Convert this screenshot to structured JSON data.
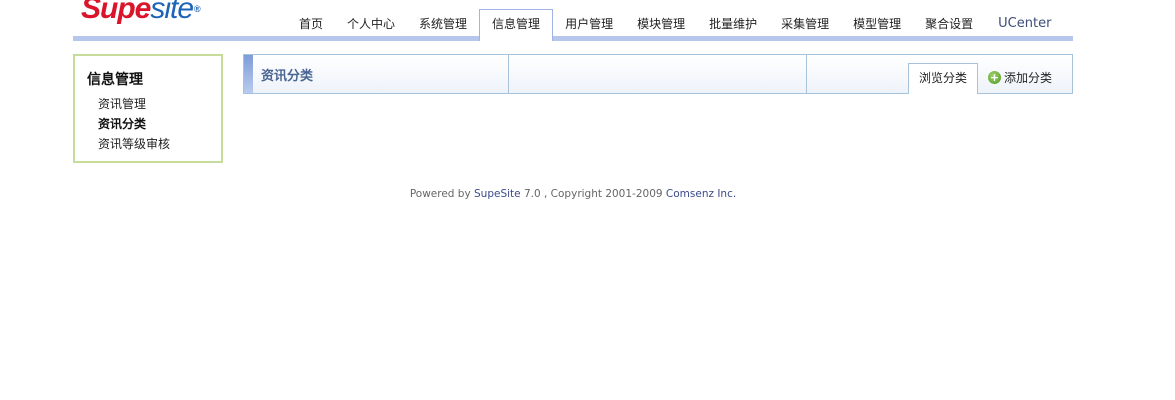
{
  "header": {
    "logo": {
      "part1": "Supe",
      "part2": "site",
      "mark": "®"
    },
    "nav": [
      {
        "label": "首页",
        "active": false
      },
      {
        "label": "个人中心",
        "active": false
      },
      {
        "label": "系统管理",
        "active": false
      },
      {
        "label": "信息管理",
        "active": true
      },
      {
        "label": "用户管理",
        "active": false
      },
      {
        "label": "模块管理",
        "active": false
      },
      {
        "label": "批量维护",
        "active": false
      },
      {
        "label": "采集管理",
        "active": false
      },
      {
        "label": "模型管理",
        "active": false
      },
      {
        "label": "聚合设置",
        "active": false
      },
      {
        "label": "UCenter",
        "active": false
      }
    ]
  },
  "sidebar": {
    "title": "信息管理",
    "items": [
      {
        "label": "资讯管理",
        "current": false
      },
      {
        "label": "资讯分类",
        "current": true
      },
      {
        "label": "资讯等级审核",
        "current": false
      }
    ]
  },
  "main": {
    "title": "资讯分类",
    "tabs": {
      "browse": "浏览分类",
      "add": "添加分类"
    }
  },
  "footer": {
    "powered_by": "Powered by",
    "product": "SupeSite",
    "version": "7.0 , Copyright 2001-2009",
    "company": "Comsenz Inc."
  },
  "colors": {
    "logo_red": "#d9142b",
    "logo_blue": "#1d63b8",
    "nav_bar": "#b7c6ec",
    "sidebar_border": "#c8dc9c",
    "main_title": "#4a6592"
  }
}
